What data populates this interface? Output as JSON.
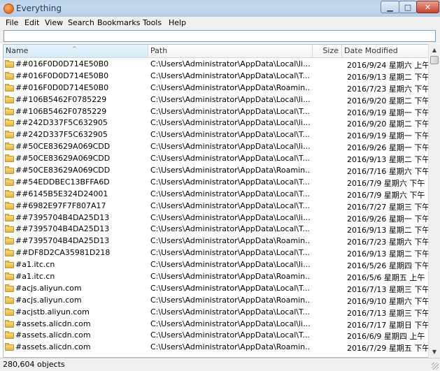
{
  "window": {
    "title": "Everything"
  },
  "menu": [
    "File",
    "Edit",
    "View",
    "Search",
    "Bookmarks",
    "Tools",
    "Help"
  ],
  "search": {
    "value": ""
  },
  "columns": {
    "name": "Name",
    "path": "Path",
    "size": "Size",
    "date": "Date Modified"
  },
  "rows": [
    {
      "name": "##016F0D0D714E50B0",
      "path": "C:\\Users\\Administrator\\AppData\\Local\\li...",
      "date": "2016/9/24 星期六 上午 ..."
    },
    {
      "name": "##016F0D0D714E50B0",
      "path": "C:\\Users\\Administrator\\AppData\\Local\\T...",
      "date": "2016/9/13 星期二 下午 ..."
    },
    {
      "name": "##016F0D0D714E50B0",
      "path": "C:\\Users\\Administrator\\AppData\\Roamin...",
      "date": "2016/7/23 星期六 下午 ..."
    },
    {
      "name": "##106B5462F0785229",
      "path": "C:\\Users\\Administrator\\AppData\\Local\\li...",
      "date": "2016/9/20 星期二 下午 ..."
    },
    {
      "name": "##106B5462F0785229",
      "path": "C:\\Users\\Administrator\\AppData\\Local\\T...",
      "date": "2016/9/19 星期一 下午 ..."
    },
    {
      "name": "##242D337F5C632905",
      "path": "C:\\Users\\Administrator\\AppData\\Local\\li...",
      "date": "2016/9/20 星期二 下午 ..."
    },
    {
      "name": "##242D337F5C632905",
      "path": "C:\\Users\\Administrator\\AppData\\Local\\T...",
      "date": "2016/9/19 星期一 下午 ..."
    },
    {
      "name": "##50CE83629A069CDD",
      "path": "C:\\Users\\Administrator\\AppData\\Local\\li...",
      "date": "2016/9/26 星期一 下午 ..."
    },
    {
      "name": "##50CE83629A069CDD",
      "path": "C:\\Users\\Administrator\\AppData\\Local\\T...",
      "date": "2016/9/13 星期二 下午 ..."
    },
    {
      "name": "##50CE83629A069CDD",
      "path": "C:\\Users\\Administrator\\AppData\\Roamin...",
      "date": "2016/7/16 星期六 下午 ..."
    },
    {
      "name": "##54EDDBEC13BFFA6D",
      "path": "C:\\Users\\Administrator\\AppData\\Local\\T...",
      "date": "2016/7/9 星期六 下午 1..."
    },
    {
      "name": "##6145B5E324D24001",
      "path": "C:\\Users\\Administrator\\AppData\\Local\\T...",
      "date": "2016/7/9 星期六 下午 1..."
    },
    {
      "name": "##6982E97F7F807A17",
      "path": "C:\\Users\\Administrator\\AppData\\Local\\T...",
      "date": "2016/7/27 星期三 下午 ..."
    },
    {
      "name": "##7395704B4DA25D13",
      "path": "C:\\Users\\Administrator\\AppData\\Local\\li...",
      "date": "2016/9/26 星期一 下午 ..."
    },
    {
      "name": "##7395704B4DA25D13",
      "path": "C:\\Users\\Administrator\\AppData\\Local\\T...",
      "date": "2016/9/13 星期二 下午 ..."
    },
    {
      "name": "##7395704B4DA25D13",
      "path": "C:\\Users\\Administrator\\AppData\\Roamin...",
      "date": "2016/7/23 星期六 下午 ..."
    },
    {
      "name": "##DF8D2CA35981D218",
      "path": "C:\\Users\\Administrator\\AppData\\Local\\T...",
      "date": "2016/9/13 星期二 下午 ..."
    },
    {
      "name": "#a1.itc.cn",
      "path": "C:\\Users\\Administrator\\AppData\\Local\\li...",
      "date": "2016/5/26 星期四 下午 ..."
    },
    {
      "name": "#a1.itc.cn",
      "path": "C:\\Users\\Administrator\\AppData\\Roamin...",
      "date": "2016/5/6 星期五 上午 1..."
    },
    {
      "name": "#acjs.aliyun.com",
      "path": "C:\\Users\\Administrator\\AppData\\Local\\T...",
      "date": "2016/7/13 星期三 下午 ..."
    },
    {
      "name": "#acjs.aliyun.com",
      "path": "C:\\Users\\Administrator\\AppData\\Roamin...",
      "date": "2016/9/10 星期六 下午 ..."
    },
    {
      "name": "#acjstb.aliyun.com",
      "path": "C:\\Users\\Administrator\\AppData\\Local\\T...",
      "date": "2016/7/13 星期三 下午 ..."
    },
    {
      "name": "#assets.alicdn.com",
      "path": "C:\\Users\\Administrator\\AppData\\Local\\li...",
      "date": "2016/7/17 星期日 下午 ..."
    },
    {
      "name": "#assets.alicdn.com",
      "path": "C:\\Users\\Administrator\\AppData\\Local\\T...",
      "date": "2016/6/9 星期四 上午 1..."
    },
    {
      "name": "#assets.alicdn.com",
      "path": "C:\\Users\\Administrator\\AppData\\Roamin...",
      "date": "2016/7/29 星期五 下午 ..."
    }
  ],
  "status": {
    "text": "280,604 objects"
  }
}
